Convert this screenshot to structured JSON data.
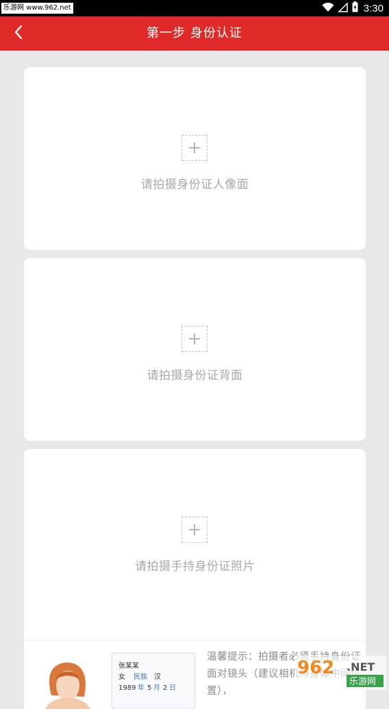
{
  "status_bar": {
    "watermark": "乐游网 www.962.net",
    "time": "3:30",
    "icons": [
      "wifi-icon",
      "signal-icon",
      "battery-icon"
    ]
  },
  "header": {
    "back_icon": "chevron-left-icon",
    "title": "第一步 身份认证",
    "background_color": "#e02a2a"
  },
  "cards": [
    {
      "label": "请拍摄身份证人像面",
      "icon": "add-icon"
    },
    {
      "label": "请拍摄身份证背面",
      "icon": "add-icon"
    },
    {
      "label": "请拍摄手持身份证照片",
      "icon": "add-icon"
    }
  ],
  "tip": {
    "text": "温馨提示：拍摄者必须手持身份证面对镜头（建议相机与身体中间位置），",
    "illustration": {
      "name": "张某某",
      "gender": "女",
      "ethnicity_label": "民族",
      "ethnicity": "汉",
      "birth_year": "1989",
      "birth_year_unit": "年",
      "birth_month": "5",
      "birth_month_unit": "月",
      "birth_day": "2",
      "birth_day_unit": "日"
    }
  },
  "site_watermark": {
    "brand": "962",
    "tld": ".NET",
    "label": "乐游网"
  }
}
